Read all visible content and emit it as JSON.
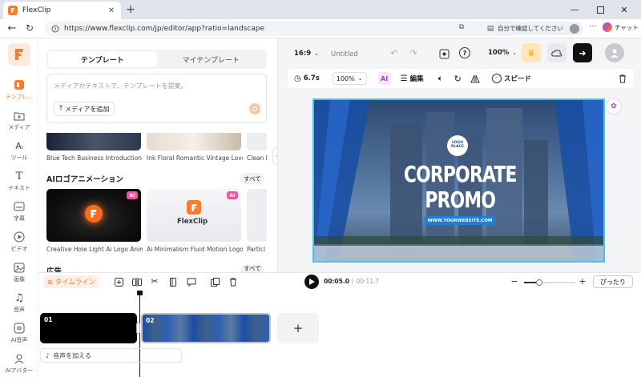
{
  "browser": {
    "tab_title": "FlexClip",
    "url": "https://www.flexclip.com/jp/editor/app?ratio=landscape",
    "profile_text": "自分で確認してください",
    "copilot_label": "チャット"
  },
  "rail": {
    "items": [
      {
        "label": "テンプレ..."
      },
      {
        "label": "メディア"
      },
      {
        "label": "ツール"
      },
      {
        "label": "テキスト"
      },
      {
        "label": "字幕"
      },
      {
        "label": "ビデオ"
      },
      {
        "label": "画像"
      },
      {
        "label": "音声"
      },
      {
        "label": "AI音声"
      },
      {
        "label": "AIアバター"
      }
    ]
  },
  "panel": {
    "tabs": [
      "テンプレート",
      "マイテンプレート"
    ],
    "prompt_placeholder": "メディアかテキストで、テンプレートを提案。",
    "add_media": "メディアを追加",
    "top_captions": [
      "Blue Tech Business Introduction ...",
      "Ink Floral Romantic Vintage Love...",
      "Clean I"
    ],
    "section_title": "AIロゴアニメーション",
    "see_all": "すべて",
    "ai_badge": "AI",
    "logo_text": "FlexClip",
    "ai_captions": [
      "Creative Hole Light Ai Logo Anim...",
      "Ai Minimalism Fluid Motion Logo...",
      "Particl"
    ],
    "next_section_title": "広告",
    "next_see_all": "すべて"
  },
  "editor": {
    "aspect": "16:9",
    "project_name": "Untitled",
    "zoom": "100%",
    "toolbar": {
      "duration": "6.7s",
      "scale": "100%",
      "ai_label": "AI",
      "edit_label": "編集",
      "speed_label": "スピード"
    },
    "canvas": {
      "logo_text": "LOGO PLACE",
      "headline_1": "CORPORATE",
      "headline_2": "PROMO",
      "website": "WWW.YOURWEBSITE.COM"
    }
  },
  "timeline": {
    "label": "タイムライン",
    "current_time": "00:05.0",
    "separator": "/",
    "total_time": "00:11.7",
    "fit_label": "ぴったり",
    "zoom_level": 0.3,
    "clips": [
      {
        "number": "01"
      },
      {
        "number": "02"
      }
    ],
    "add_audio": "音声を加える"
  },
  "colors": {
    "accent": "#ff7a29",
    "canvas_blue": "#1a4fa3",
    "selection": "#45c3ea"
  }
}
